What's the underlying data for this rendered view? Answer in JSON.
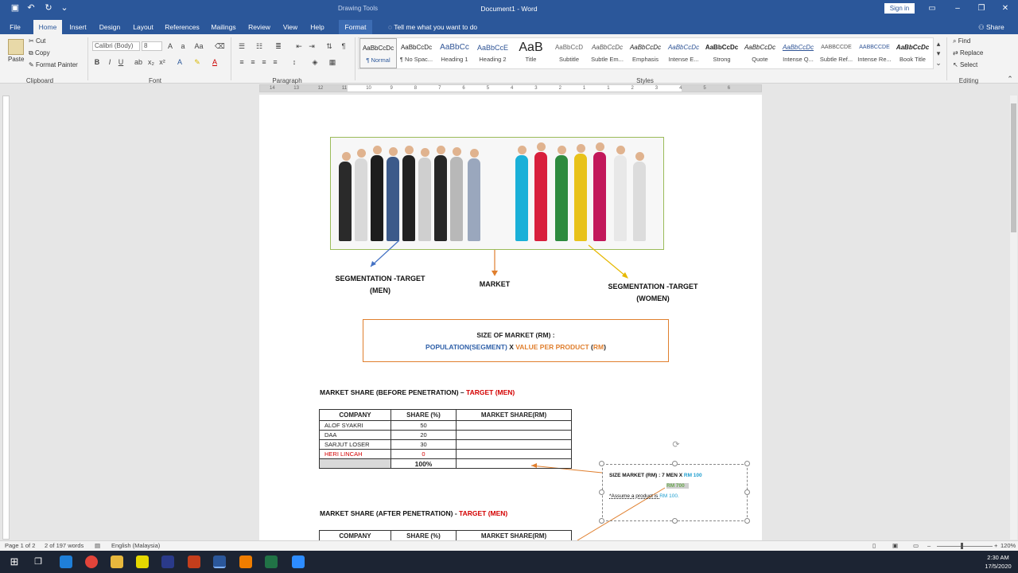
{
  "titlebar": {
    "context_label": "Drawing Tools",
    "title": "Document1 - Word",
    "signin": "Sign in"
  },
  "tabs": [
    {
      "label": "File"
    },
    {
      "label": "Home"
    },
    {
      "label": "Insert"
    },
    {
      "label": "Design"
    },
    {
      "label": "Layout"
    },
    {
      "label": "References"
    },
    {
      "label": "Mailings"
    },
    {
      "label": "Review"
    },
    {
      "label": "View"
    },
    {
      "label": "Help"
    },
    {
      "label": "Format"
    }
  ],
  "tell_me": "Tell me what you want to do",
  "share": "Share",
  "ribbon": {
    "clipboard": {
      "paste": "Paste",
      "cut": "Cut",
      "copy": "Copy",
      "format_painter": "Format Painter",
      "group": "Clipboard"
    },
    "font": {
      "name": "Calibri (Body)",
      "size": "8",
      "group": "Font"
    },
    "paragraph": {
      "group": "Paragraph"
    },
    "styles": {
      "group": "Styles",
      "items": [
        {
          "sample": "AaBbCcDc",
          "name": "¶ Normal"
        },
        {
          "sample": "AaBbCcDc",
          "name": "¶ No Spac..."
        },
        {
          "sample": "AaBbCc",
          "name": "Heading 1"
        },
        {
          "sample": "AaBbCcE",
          "name": "Heading 2"
        },
        {
          "sample": "AaB",
          "name": "Title"
        },
        {
          "sample": "AaBbCcD",
          "name": "Subtitle"
        },
        {
          "sample": "AaBbCcDc",
          "name": "Subtle Em..."
        },
        {
          "sample": "AaBbCcDc",
          "name": "Emphasis"
        },
        {
          "sample": "AaBbCcDc",
          "name": "Intense E..."
        },
        {
          "sample": "AaBbCcDc",
          "name": "Strong"
        },
        {
          "sample": "AaBbCcDc",
          "name": "Quote"
        },
        {
          "sample": "AaBbCcDc",
          "name": "Intense Q..."
        },
        {
          "sample": "AABBCCDE",
          "name": "Subtle Ref..."
        },
        {
          "sample": "AABBCCDE",
          "name": "Intense Re..."
        },
        {
          "sample": "AaBbCcDc",
          "name": "Book Title"
        }
      ]
    },
    "editing": {
      "find": "Find",
      "replace": "Replace",
      "select": "Select",
      "group": "Editing"
    }
  },
  "ruler_marks": [
    "14",
    "13",
    "12",
    "11",
    "10",
    "9",
    "8",
    "7",
    "6",
    "5",
    "4",
    "3",
    "2",
    "1",
    "1",
    "2",
    "3",
    "4",
    "5",
    "6"
  ],
  "document": {
    "label_men": "SEGMENTATION -TARGET\n(MEN)",
    "label_market": "MARKET",
    "label_women": "SEGMENTATION -TARGET\n(WOMEN)",
    "size_line1": "SIZE OF MARKET (RM) :",
    "size_pop": "POPULATION(SEGMENT)",
    "size_x": " X ",
    "size_value": "VALUE PER PRODUCT",
    "size_rm_open": " (",
    "size_rm": "RM",
    "size_rm_close": ")",
    "heading1_prefix": "MARKET SHARE (BEFORE PENETRATION) – ",
    "heading1_target": "TARGET (MEN)",
    "heading2_prefix": "MARKET SHARE (AFTER PENETRATION) - ",
    "heading2_target": "TARGET (MEN)",
    "table_headers": [
      "COMPANY",
      "SHARE (%)",
      "MARKET SHARE(RM)"
    ],
    "table_rows": [
      {
        "company": "ALOF SYAKRI",
        "share": "50"
      },
      {
        "company": "DAA",
        "share": "20"
      },
      {
        "company": "SARJUT LOSER",
        "share": "30"
      },
      {
        "company": "HERI LINCAH",
        "share": "0"
      }
    ],
    "table_total": "100%",
    "textbox": {
      "line1_prefix": "SIZE MARKET (RM) : 7 MEN X ",
      "line1_value": "RM 100",
      "line2": "RM 700",
      "line3_prefix": "*Assume a product  is ",
      "line3_value": "RM 100."
    }
  },
  "status": {
    "page": "Page 1 of 2",
    "words": "2 of 197 words",
    "language": "English (Malaysia)",
    "zoom": "120%"
  },
  "clock": {
    "time": "2:30 AM",
    "date": "17/5/2020"
  },
  "colors": {
    "word_blue": "#2b579a",
    "accent_orange": "#e07f2e",
    "target_red": "#d40000",
    "population_blue": "#2e5fa8"
  }
}
